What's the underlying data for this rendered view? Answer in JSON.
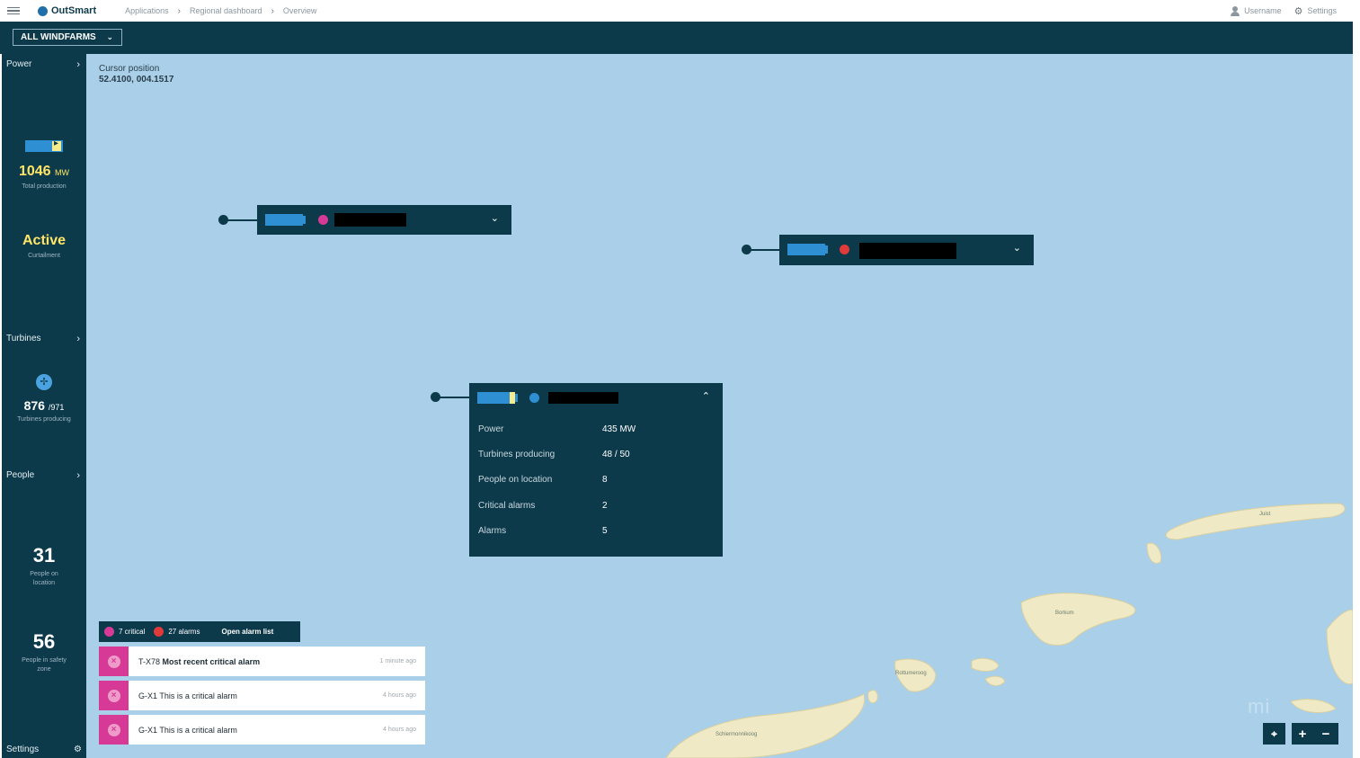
{
  "app": {
    "name": "OutSmart"
  },
  "breadcrumb": [
    "Applications",
    "Regional dashboard",
    "Overview"
  ],
  "user": {
    "username": "Username",
    "settings": "Settings"
  },
  "filter": {
    "windfarm_selected": "ALL WINDFARMS"
  },
  "sidebar": {
    "power_label": "Power",
    "total_production_value": "1046",
    "total_production_unit": "MW",
    "total_production_caption": "Total production",
    "curtailment_value": "Active",
    "curtailment_caption": "Curtailment",
    "turbines_label": "Turbines",
    "turbines_producing_value": "876",
    "turbines_total": "/971",
    "turbines_caption": "Turbines producing",
    "people_label": "People",
    "people_on_location_value": "31",
    "people_on_location_caption": "People on location",
    "people_safety_value": "56",
    "people_safety_caption": "People in safety zone",
    "settings_label": "Settings"
  },
  "map": {
    "cursor_label": "Cursor position",
    "cursor_value": "52.4100, 004.1517",
    "place_labels": [
      "Borkum",
      "Schiermonnikoog",
      "Rottumeroog",
      "Juist"
    ]
  },
  "windfarms": [
    {
      "status_color": "#d63a96",
      "collapsed": true
    },
    {
      "status_color": "#e03a3a",
      "collapsed": true
    },
    {
      "status_color": "#2f8fd3",
      "collapsed": false,
      "details": [
        {
          "key": "Power",
          "value": "435 MW"
        },
        {
          "key": "Turbines producing",
          "value": "48 / 50"
        },
        {
          "key": "People on location",
          "value": "8"
        },
        {
          "key": "Critical alarms",
          "value": "2"
        },
        {
          "key": "Alarms",
          "value": "5"
        }
      ]
    }
  ],
  "alarms": {
    "critical_count": "7 critical",
    "alarm_count": "27 alarms",
    "open_list_label": "Open alarm list",
    "critical_color": "#d63a96",
    "alarm_color": "#e03a3a",
    "items": [
      {
        "id": "T-X78",
        "text": "Most recent critical alarm",
        "time": "1 minute ago"
      },
      {
        "id": "G-X1",
        "text": "This is a critical alarm",
        "time": "4 hours ago"
      },
      {
        "id": "G-X1",
        "text": "This is a critical alarm",
        "time": "4 hours ago"
      }
    ]
  },
  "controls": {
    "locate_icon": "locate-icon",
    "zoom_in": "+",
    "zoom_out": "−"
  },
  "watermark": "mi"
}
